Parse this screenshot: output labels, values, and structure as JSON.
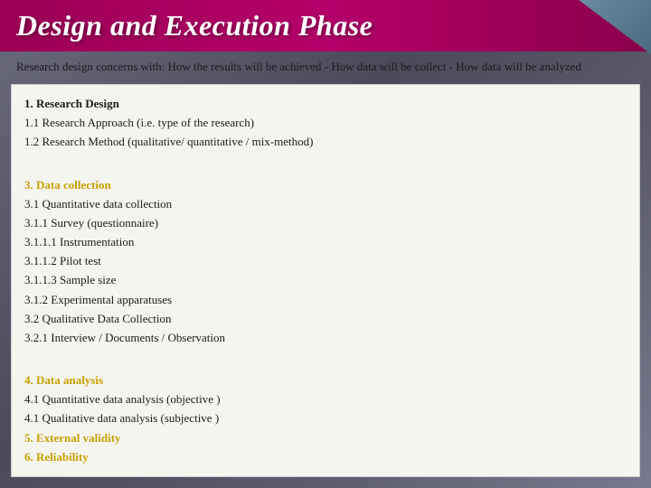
{
  "title": "Design and Execution Phase",
  "subtitle": "Research design concerns with: How the results will be achieved - How data will be collect - How data will be analyzed",
  "content": {
    "item1": {
      "label": "1.   Research Design",
      "item1_1": "1.1   Research Approach (i.e. type of the research)",
      "item1_2": "1.2   Research Method (qualitative/ quantitative / mix-method)"
    },
    "item3": {
      "label": "3.   Data collection",
      "item3_1": "3.1   Quantitative data collection",
      "item3_1_1": "3.1.1   Survey (questionnaire)",
      "item3_1_1_1": "3.1.1.1   Instrumentation",
      "item3_1_1_2": "3.1.1.2   Pilot test",
      "item3_1_1_3": "3.1.1.3   Sample size",
      "item3_1_2": "3.1.2   Experimental apparatuses",
      "item3_2": "3.2   Qualitative Data Collection",
      "item3_2_1": "3.2.1   Interview / Documents / Observation"
    },
    "item4": {
      "label": "4.   Data analysis",
      "item4_1_obj": "4.1   Quantitative data analysis (objective )",
      "item4_1_subj": "4.1   Qualitative data analysis (subjective )"
    },
    "item5": {
      "label": "5.   External validity"
    },
    "item6": {
      "label": "6.   Reliability"
    }
  },
  "colors": {
    "title_bg": "#9b0055",
    "highlight": "#c8a000",
    "content_bg": "#f5f5f0"
  }
}
